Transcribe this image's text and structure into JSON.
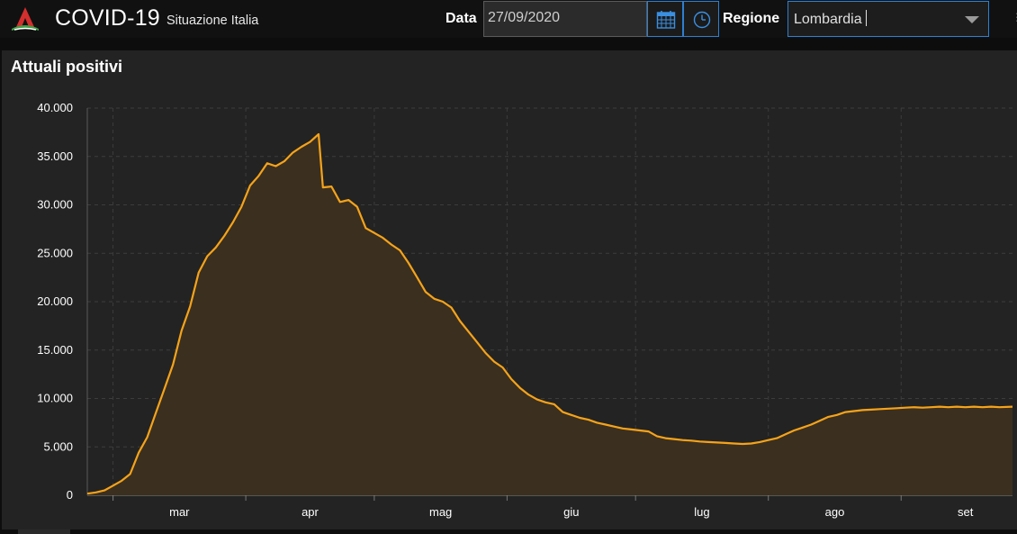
{
  "header": {
    "app_title": "COVID-19",
    "app_subtitle": "Situazione Italia",
    "logo_icon": "virus-logo-icon",
    "date_label": "Data",
    "date_value": "27/09/2020",
    "calendar_icon": "calendar-icon",
    "clock_icon": "clock-icon",
    "region_label": "Regione",
    "region_value": "Lombardia",
    "accent_color": "#2f7fd0"
  },
  "panel": {
    "title": "Attuali positivi"
  },
  "chart_data": {
    "type": "area",
    "title": "Attuali positivi",
    "xlabel": "",
    "ylabel": "",
    "line_color": "#f5a31a",
    "fill_color": "#3b2f1f",
    "grid": true,
    "ylim": [
      0,
      40000
    ],
    "yticks": [
      0,
      5000,
      10000,
      15000,
      20000,
      25000,
      30000,
      35000,
      40000
    ],
    "ytick_labels": [
      "0",
      "5.000",
      "10.000",
      "15.000",
      "20.000",
      "25.000",
      "30.000",
      "35.000",
      "40.000"
    ],
    "xlim": [
      "2020-02-24",
      "2020-09-27"
    ],
    "xticks": [
      {
        "label": "mar",
        "date": "2020-03-01"
      },
      {
        "label": "apr",
        "date": "2020-04-01"
      },
      {
        "label": "mag",
        "date": "2020-05-01"
      },
      {
        "label": "giu",
        "date": "2020-06-01"
      },
      {
        "label": "lug",
        "date": "2020-07-01"
      },
      {
        "label": "ago",
        "date": "2020-08-01"
      },
      {
        "label": "set",
        "date": "2020-09-01"
      }
    ],
    "series": [
      {
        "values": [
          [
            "2020-02-24",
            170
          ],
          [
            "2020-02-26",
            300
          ],
          [
            "2020-02-28",
            500
          ],
          [
            "2020-03-01",
            1000
          ],
          [
            "2020-03-03",
            1500
          ],
          [
            "2020-03-05",
            2200
          ],
          [
            "2020-03-07",
            4400
          ],
          [
            "2020-03-09",
            6000
          ],
          [
            "2020-03-11",
            8500
          ],
          [
            "2020-03-13",
            11000
          ],
          [
            "2020-03-15",
            13500
          ],
          [
            "2020-03-17",
            17000
          ],
          [
            "2020-03-19",
            19500
          ],
          [
            "2020-03-21",
            23000
          ],
          [
            "2020-03-23",
            24700
          ],
          [
            "2020-03-25",
            25600
          ],
          [
            "2020-03-27",
            26800
          ],
          [
            "2020-03-29",
            28200
          ],
          [
            "2020-03-31",
            29800
          ],
          [
            "2020-04-02",
            32000
          ],
          [
            "2020-04-04",
            33000
          ],
          [
            "2020-04-06",
            34300
          ],
          [
            "2020-04-08",
            34000
          ],
          [
            "2020-04-10",
            34500
          ],
          [
            "2020-04-12",
            35400
          ],
          [
            "2020-04-14",
            36000
          ],
          [
            "2020-04-16",
            36500
          ],
          [
            "2020-04-18",
            37300
          ],
          [
            "2020-04-19",
            31800
          ],
          [
            "2020-04-21",
            31900
          ],
          [
            "2020-04-23",
            30300
          ],
          [
            "2020-04-25",
            30500
          ],
          [
            "2020-04-27",
            29800
          ],
          [
            "2020-04-29",
            27600
          ],
          [
            "2020-05-01",
            27100
          ],
          [
            "2020-05-03",
            26600
          ],
          [
            "2020-05-05",
            25900
          ],
          [
            "2020-05-07",
            25300
          ],
          [
            "2020-05-09",
            24000
          ],
          [
            "2020-05-11",
            22500
          ],
          [
            "2020-05-13",
            21000
          ],
          [
            "2020-05-15",
            20300
          ],
          [
            "2020-05-17",
            20000
          ],
          [
            "2020-05-19",
            19400
          ],
          [
            "2020-05-21",
            18000
          ],
          [
            "2020-05-23",
            16900
          ],
          [
            "2020-05-25",
            15800
          ],
          [
            "2020-05-27",
            14700
          ],
          [
            "2020-05-29",
            13800
          ],
          [
            "2020-05-31",
            13200
          ],
          [
            "2020-06-02",
            12000
          ],
          [
            "2020-06-04",
            11100
          ],
          [
            "2020-06-06",
            10400
          ],
          [
            "2020-06-08",
            9900
          ],
          [
            "2020-06-10",
            9600
          ],
          [
            "2020-06-12",
            9400
          ],
          [
            "2020-06-14",
            8600
          ],
          [
            "2020-06-16",
            8300
          ],
          [
            "2020-06-18",
            8000
          ],
          [
            "2020-06-20",
            7800
          ],
          [
            "2020-06-22",
            7500
          ],
          [
            "2020-06-24",
            7300
          ],
          [
            "2020-06-26",
            7100
          ],
          [
            "2020-06-28",
            6900
          ],
          [
            "2020-06-30",
            6800
          ],
          [
            "2020-07-02",
            6700
          ],
          [
            "2020-07-04",
            6600
          ],
          [
            "2020-07-06",
            6100
          ],
          [
            "2020-07-08",
            5900
          ],
          [
            "2020-07-10",
            5800
          ],
          [
            "2020-07-12",
            5700
          ],
          [
            "2020-07-14",
            5650
          ],
          [
            "2020-07-16",
            5550
          ],
          [
            "2020-07-18",
            5500
          ],
          [
            "2020-07-20",
            5450
          ],
          [
            "2020-07-22",
            5400
          ],
          [
            "2020-07-24",
            5350
          ],
          [
            "2020-07-26",
            5300
          ],
          [
            "2020-07-28",
            5350
          ],
          [
            "2020-07-30",
            5500
          ],
          [
            "2020-08-01",
            5700
          ],
          [
            "2020-08-03",
            5900
          ],
          [
            "2020-08-05",
            6300
          ],
          [
            "2020-08-07",
            6700
          ],
          [
            "2020-08-09",
            7000
          ],
          [
            "2020-08-11",
            7300
          ],
          [
            "2020-08-13",
            7700
          ],
          [
            "2020-08-15",
            8100
          ],
          [
            "2020-08-17",
            8300
          ],
          [
            "2020-08-19",
            8600
          ],
          [
            "2020-08-21",
            8700
          ],
          [
            "2020-08-23",
            8800
          ],
          [
            "2020-08-25",
            8850
          ],
          [
            "2020-08-27",
            8900
          ],
          [
            "2020-08-29",
            8950
          ],
          [
            "2020-08-31",
            9000
          ],
          [
            "2020-09-02",
            9050
          ],
          [
            "2020-09-04",
            9100
          ],
          [
            "2020-09-06",
            9050
          ],
          [
            "2020-09-08",
            9100
          ],
          [
            "2020-09-10",
            9150
          ],
          [
            "2020-09-12",
            9100
          ],
          [
            "2020-09-14",
            9150
          ],
          [
            "2020-09-16",
            9100
          ],
          [
            "2020-09-18",
            9150
          ],
          [
            "2020-09-20",
            9100
          ],
          [
            "2020-09-22",
            9150
          ],
          [
            "2020-09-24",
            9100
          ],
          [
            "2020-09-27",
            9150
          ]
        ]
      }
    ]
  }
}
